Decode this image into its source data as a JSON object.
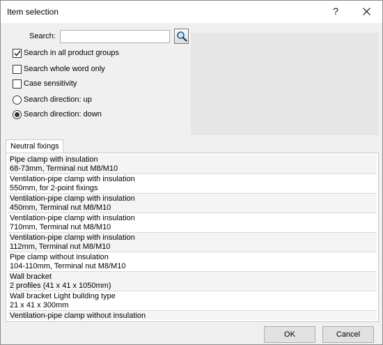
{
  "window": {
    "title": "Item selection",
    "help_label": "?",
    "close_icon": "close-icon"
  },
  "search": {
    "label": "Search:",
    "value": "",
    "placeholder": "",
    "button_icon": "magnifier-icon"
  },
  "options": {
    "all_groups": {
      "label": "Search in all product groups",
      "checked": true
    },
    "whole_word": {
      "label": "Search whole word only",
      "checked": false
    },
    "case_sensitivity": {
      "label": "Case sensitivity",
      "checked": false
    },
    "direction_up": {
      "label": "Search direction: up",
      "selected": false
    },
    "direction_down": {
      "label": "Search direction: down",
      "selected": true
    }
  },
  "tab": {
    "label": "Neutral fixings"
  },
  "items": [
    {
      "line1": "Pipe clamp with insulation",
      "line2": "68-73mm, Terminal nut M8/M10"
    },
    {
      "line1": "Ventilation-pipe clamp with insulation",
      "line2": "550mm, for 2-point fixings"
    },
    {
      "line1": "Ventilation-pipe clamp with insulation",
      "line2": "450mm, Terminal nut M8/M10"
    },
    {
      "line1": "Ventilation-pipe clamp with insulation",
      "line2": "710mm, Terminal nut M8/M10"
    },
    {
      "line1": "Ventilation-pipe clamp with insulation",
      "line2": "112mm, Terminal nut M8/M10"
    },
    {
      "line1": "Pipe clamp without insulation",
      "line2": "104-110mm, Terminal nut M8/M10"
    },
    {
      "line1": "Wall bracket",
      "line2": "2 profiles (41 x 41 x 1050mm)"
    },
    {
      "line1": "Wall bracket Light building type",
      "line2": "21 x 41 x 300mm"
    },
    {
      "line1": "Ventilation-pipe clamp without insulation",
      "line2": ""
    }
  ],
  "footer": {
    "ok_label": "OK",
    "cancel_label": "Cancel"
  }
}
